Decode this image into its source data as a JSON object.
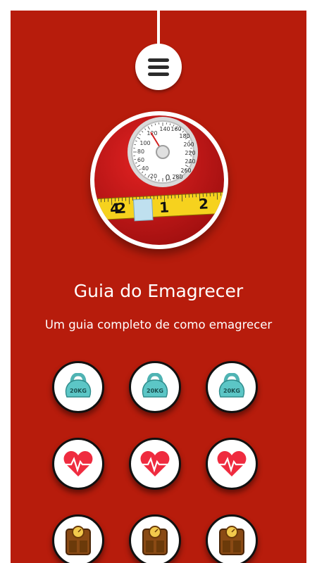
{
  "app": {
    "title": "Guia do Emagrecer",
    "subtitle": "Um guia completo de como emagrecer"
  },
  "logo": {
    "scale_numbers": [
      "140",
      "160",
      "180",
      "120",
      "200",
      "100",
      "220",
      "80",
      "240",
      "60",
      "260",
      "40",
      "20",
      "0",
      "280"
    ],
    "tape_numbers": [
      "2",
      "1",
      "2",
      "4"
    ]
  },
  "grid": {
    "rows": [
      {
        "icon": "kettlebell-icon",
        "label": "20KG"
      },
      {
        "icon": "heart-pulse-icon"
      },
      {
        "icon": "scale-icon"
      }
    ]
  }
}
